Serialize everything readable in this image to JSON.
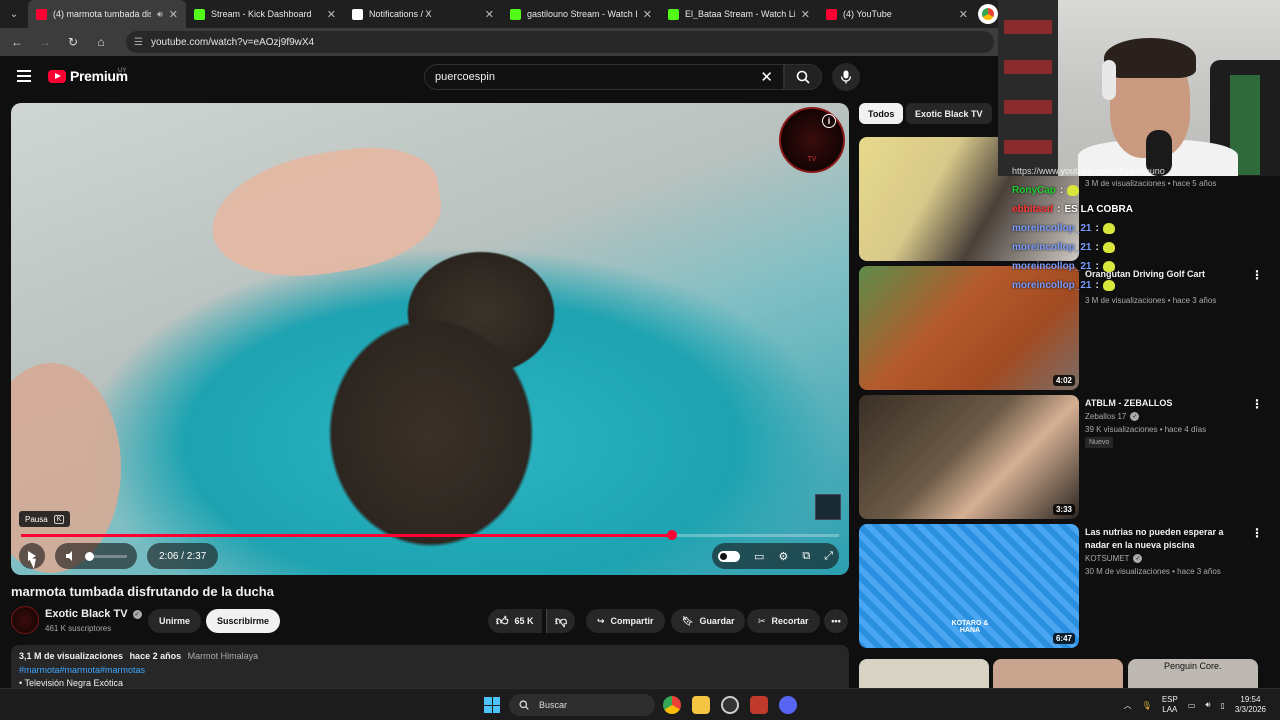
{
  "browser": {
    "tabs": [
      {
        "title": "(4) marmota tumbada disfr",
        "favicon_color": "#ff0033",
        "active": true,
        "audio": true
      },
      {
        "title": "Stream - Kick Dashboard",
        "favicon_color": "#53fc18",
        "active": false
      },
      {
        "title": "Notifications / X",
        "favicon_color": "#ffffff",
        "active": false
      },
      {
        "title": "gastilouno Stream - Watch Live",
        "favicon_color": "#53fc18",
        "active": false
      },
      {
        "title": "El_Bataa Stream - Watch Live o",
        "favicon_color": "#53fc18",
        "active": false
      },
      {
        "title": "(4) YouTube",
        "favicon_color": "#ff0033",
        "active": false
      }
    ],
    "url": "youtube.com/watch?v=eAOzj9f9wX4"
  },
  "youtube": {
    "logo_text": "Premium",
    "country_code": "UY",
    "search_query": "puercoespin"
  },
  "player": {
    "tooltip_label": "Pausa",
    "tooltip_key": "K",
    "time_current": "2:06",
    "time_total": "2:37",
    "time_display": "2:06 / 2:37",
    "progress_fraction": 0.796,
    "channel_logo_text": "TV"
  },
  "video": {
    "title": "marmota tumbada disfrutando de la ducha",
    "channel": "Exotic Black TV",
    "subscribers": "461 K suscriptores",
    "join_label": "Unirme",
    "subscribe_label": "Suscribirme",
    "likes": "65 K",
    "share_label": "Compartir",
    "save_label": "Guardar",
    "clip_label": "Recortar",
    "views": "3,1 M de visualizaciones",
    "age": "hace 2 años",
    "location": "Marmot Himalaya",
    "hashtags": "#marmota#marmota#marmotas",
    "bullet": "• Televisión Negra Exótica"
  },
  "filters": {
    "all": "Todos",
    "channel": "Exotic Black TV"
  },
  "recommendations": [
    {
      "title": "",
      "channel": "",
      "meta": "3 M de visualizaciones • hace 5 años",
      "duration": "",
      "thumb_color": "#d8c98a"
    },
    {
      "title": "Orangutan Driving Golf Cart",
      "channel": "",
      "meta": "3 M de visualizaciones • hace 3 años",
      "duration": "4:02",
      "thumb_color": "#b55a2c"
    },
    {
      "title": "ATBLM - ZEBALLOS",
      "channel": "Zeballos 17",
      "meta": "39 K visualizaciones • hace 4 días",
      "badge": "Nuevo",
      "duration": "3:33",
      "thumb_color": "#6b5a46"
    },
    {
      "title": "Las nutrias no pueden esperar a nadar en la nueva piscina",
      "channel": "KOTSUMET",
      "meta": "30 M de visualizaciones • hace 3 años",
      "duration": "6:47",
      "thumb_color": "#2b8fe0",
      "thumb_text": "KOTARO & HANA"
    }
  ],
  "bottom_thumb_text": "Penguin Core.",
  "chat": {
    "header": "https://www.youtube.com/@gastilouno",
    "lines": [
      {
        "user": "RonyCap",
        "color": "#1fd12f",
        "message": "",
        "emote": true
      },
      {
        "user": "ebbitasd",
        "color": "#ff3a3a",
        "message": "ES LA COBRA",
        "emote": false
      },
      {
        "user": "moreincollop_21",
        "color": "#7a9dff",
        "message": "",
        "emote": true
      },
      {
        "user": "moreincollop_21",
        "color": "#7a9dff",
        "message": "",
        "emote": true
      },
      {
        "user": "moreincollop_21",
        "color": "#7a9dff",
        "message": "",
        "emote": true
      },
      {
        "user": "moreincollop_21",
        "color": "#7a9dff",
        "message": "",
        "emote": true
      }
    ]
  },
  "taskbar": {
    "search_label": "Buscar",
    "lang_top": "ESP",
    "lang_bottom": "LAA",
    "time": "19:54",
    "date": "3/3/2026"
  }
}
